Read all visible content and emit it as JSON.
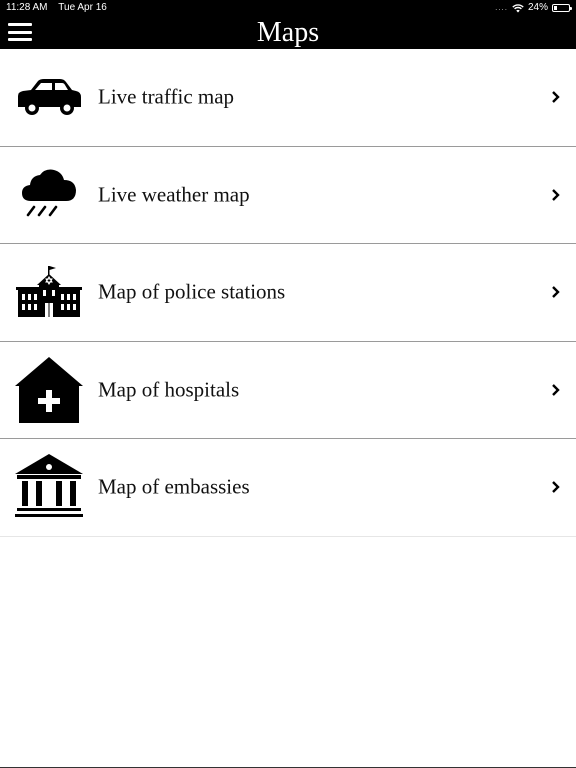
{
  "status_bar": {
    "time": "11:28 AM",
    "date": "Tue Apr 16",
    "signal": "....",
    "battery_text": "24%",
    "battery_level": 0.24,
    "wifi_icon": "wifi-icon"
  },
  "nav": {
    "title": "Maps",
    "menu_icon": "hamburger-menu-icon"
  },
  "items": [
    {
      "label": "Live traffic map",
      "icon": "car-icon"
    },
    {
      "label": "Live weather map",
      "icon": "rain-cloud-icon"
    },
    {
      "label": "Map of police stations",
      "icon": "police-station-icon"
    },
    {
      "label": "Map of hospitals",
      "icon": "hospital-icon"
    },
    {
      "label": "Map of embassies",
      "icon": "embassy-icon"
    }
  ],
  "colors": {
    "bar_background": "#000000",
    "bar_text": "#ffffff",
    "row_text": "#111111",
    "divider": "#9a9a9a"
  }
}
